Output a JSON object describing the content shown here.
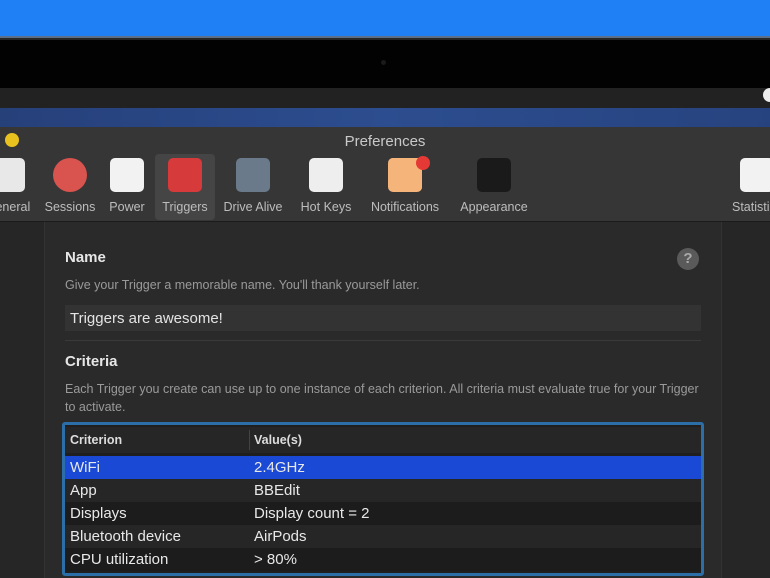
{
  "window": {
    "title": "Preferences"
  },
  "toolbar": [
    {
      "label": "General",
      "icon": "general-toggle-icon",
      "color": "#e8e8e8"
    },
    {
      "label": "Sessions",
      "icon": "sessions-clock-icon",
      "color": "#d9534f"
    },
    {
      "label": "Power",
      "icon": "power-outlet-icon",
      "color": "#f2f2f2"
    },
    {
      "label": "Triggers",
      "icon": "triggers-switch-icon",
      "color": "#d63a3a",
      "selected": true
    },
    {
      "label": "Drive Alive",
      "icon": "drive-alive-eye-icon",
      "color": "#6a7a8a"
    },
    {
      "label": "Hot Keys",
      "icon": "hot-keys-command-icon",
      "color": "#eeeeee"
    },
    {
      "label": "Notifications",
      "icon": "notifications-badge-icon",
      "color": "#f5b47a"
    },
    {
      "label": "Appearance",
      "icon": "appearance-tuxedo-icon",
      "color": "#1a1a1a"
    },
    {
      "label": "Statistics",
      "icon": "statistics-chart-icon",
      "color": "#f2f2f2"
    }
  ],
  "name_section": {
    "heading": "Name",
    "description": "Give your Trigger a memorable name. You'll thank yourself later.",
    "value": "Triggers are awesome!",
    "help": "?"
  },
  "criteria_section": {
    "heading": "Criteria",
    "description": "Each Trigger you create can use up to one instance of each criterion. All criteria must evaluate true for your Trigger to activate.",
    "columns": [
      "Criterion",
      "Value(s)"
    ],
    "rows": [
      {
        "criterion": "WiFi",
        "value": "2.4GHz",
        "selected": true
      },
      {
        "criterion": "App",
        "value": "BBEdit"
      },
      {
        "criterion": "Displays",
        "value": "Display count = 2"
      },
      {
        "criterion": "Bluetooth device",
        "value": "AirPods"
      },
      {
        "criterion": "CPU utilization",
        "value": "> 80%"
      }
    ]
  },
  "colors": {
    "selection": "#1a49d6",
    "focus_ring": "#2b6ea8",
    "accent_band": "#1f80f6"
  }
}
